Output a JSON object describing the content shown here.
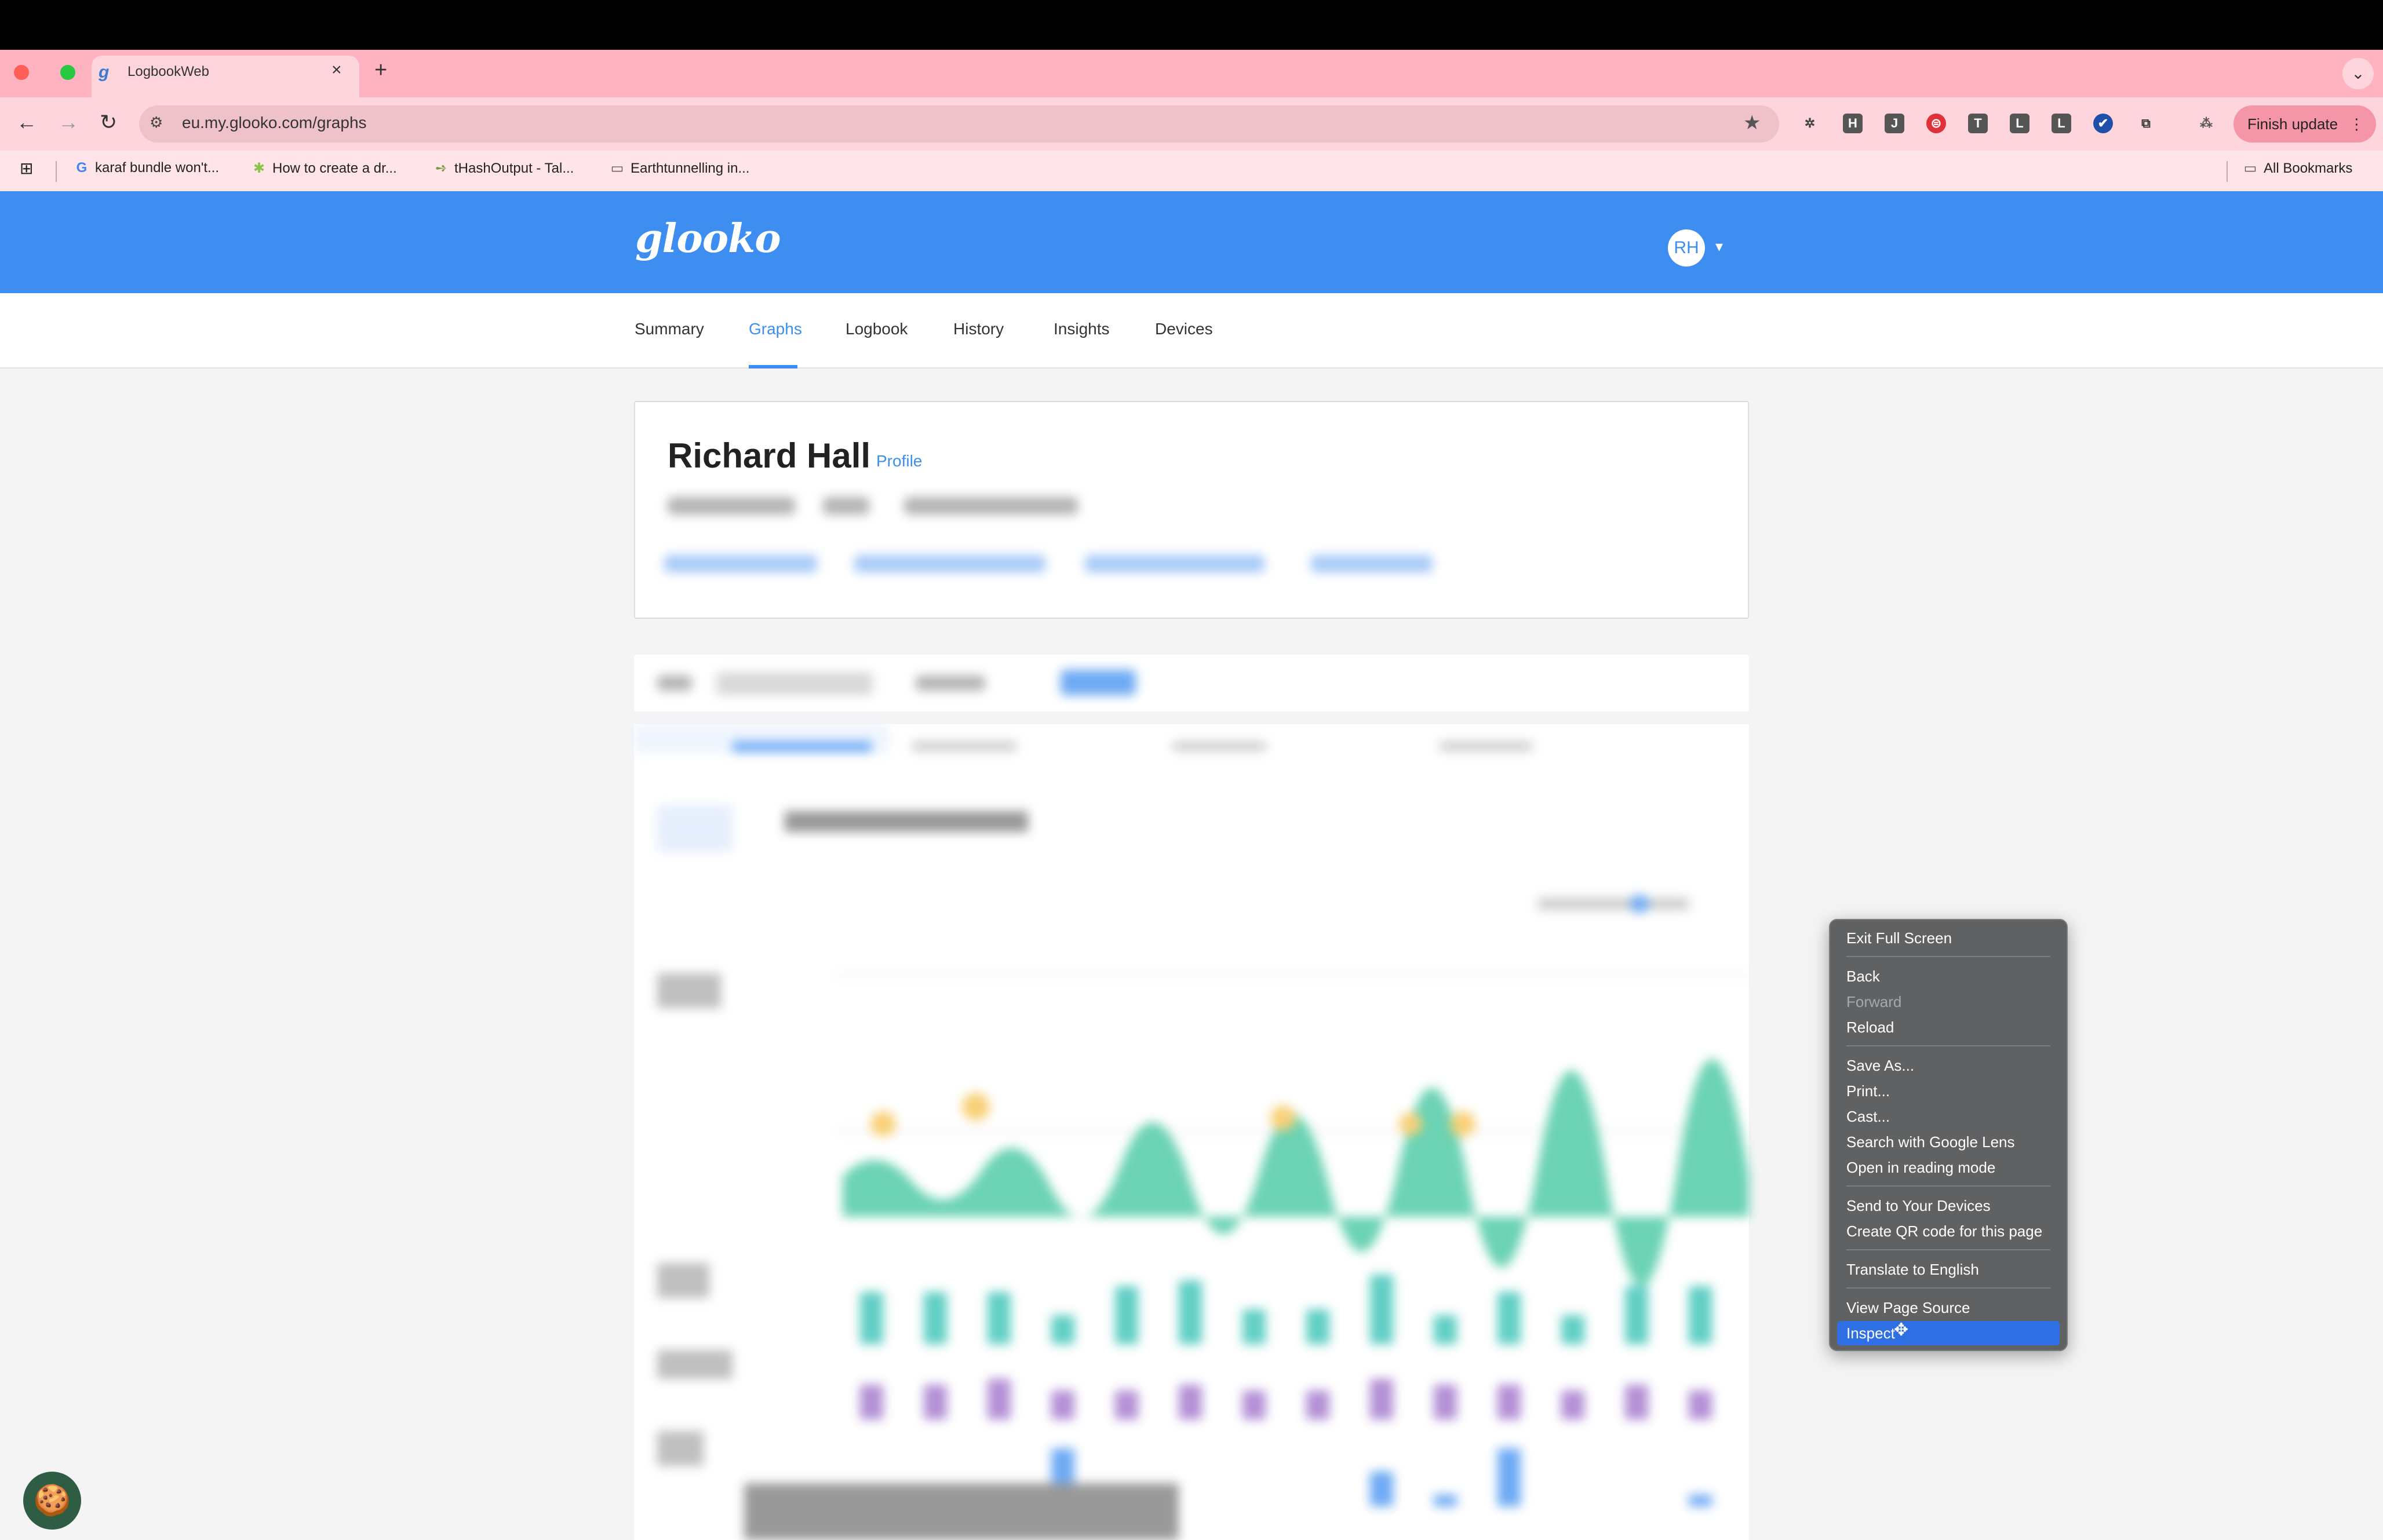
{
  "browser": {
    "tab_title": "LogbookWeb",
    "tab_favicon": "g",
    "tab_close": "×",
    "new_tab": "+",
    "tab_menu": "⌄",
    "nav": {
      "back": "←",
      "forward": "→",
      "reload": "↻"
    },
    "site_info_icon": "⚙",
    "url": "eu.my.glooko.com/graphs",
    "bookmark_star": "★",
    "extensions": [
      "✲",
      "H",
      "J",
      "⊜",
      "T",
      "L",
      "L",
      "✔",
      "⧉",
      "⁂"
    ],
    "finish_update": "Finish update",
    "overflow_menu": "⋮",
    "bookmarks_grid_icon": "⊞",
    "bookmarks": [
      {
        "icon": "G",
        "label": "karaf bundle won't..."
      },
      {
        "icon": "✱",
        "label": "How to create a dr..."
      },
      {
        "icon": "➺",
        "label": "tHashOutput - Tal..."
      },
      {
        "icon": "▭",
        "label": "Earthtunnelling  in..."
      }
    ],
    "all_bookmarks": "All Bookmarks",
    "all_bookmarks_icon": "▭"
  },
  "app": {
    "logo": "glooko",
    "avatar_initials": "RH",
    "avatar_caret": "▾",
    "nav": [
      {
        "label": "Summary"
      },
      {
        "label": "Graphs"
      },
      {
        "label": "Logbook"
      },
      {
        "label": "History"
      },
      {
        "label": "Insights"
      },
      {
        "label": "Devices"
      }
    ],
    "patient_name": "Richard Hall",
    "profile_link": "Profile"
  },
  "context_menu": {
    "items": [
      {
        "label": "Exit Full Screen"
      },
      {
        "label": "Back"
      },
      {
        "label": "Forward"
      },
      {
        "label": "Reload"
      },
      {
        "label": "Save As..."
      },
      {
        "label": "Print..."
      },
      {
        "label": "Cast..."
      },
      {
        "label": "Search with Google Lens"
      },
      {
        "label": "Open in reading mode"
      },
      {
        "label": "Send to Your Devices"
      },
      {
        "label": "Create QR code for this page"
      },
      {
        "label": "Translate to English"
      },
      {
        "label": "View Page Source"
      },
      {
        "label": "Inspect"
      }
    ],
    "cursor": "✥"
  },
  "cookie_icon": "🍪",
  "colors": {
    "tab_strip": "#ffb3c1",
    "toolbar": "#ffd5dd",
    "glooko_blue": "#3d8ef0",
    "context_menu_bg": "#5f6163",
    "context_menu_highlight": "#2f6fe4",
    "cookie_button": "#2e5d43"
  }
}
